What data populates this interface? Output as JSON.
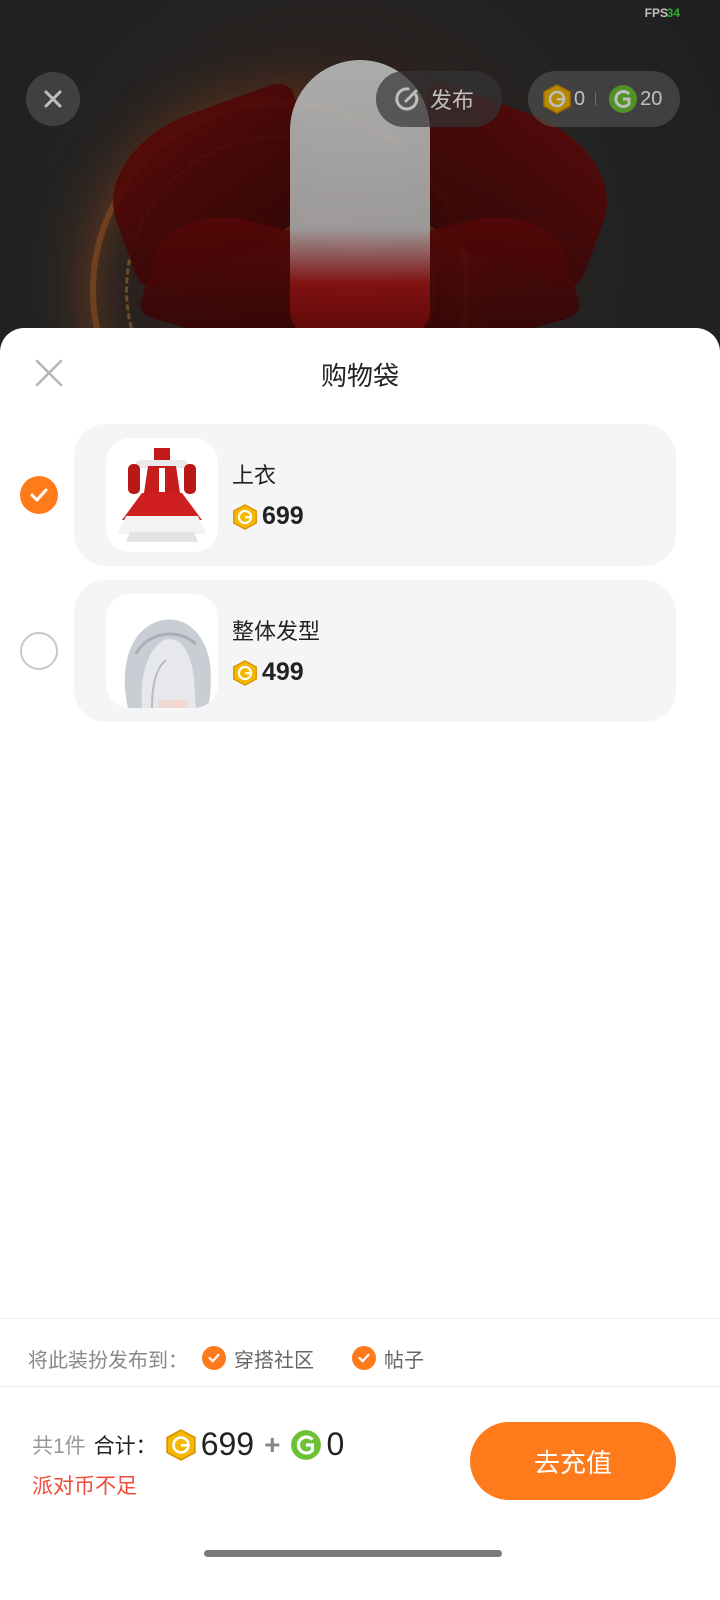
{
  "status": {
    "fps_label": "FPS",
    "fps_value": "34",
    "fps_color": "#39e639"
  },
  "topbar": {
    "publish_label": "发布",
    "gold_coins": "0",
    "green_coins": "20"
  },
  "sheet": {
    "title": "购物袋",
    "items": [
      {
        "name": "上衣",
        "price": "699",
        "selected": true,
        "thumb": "red-dress-thumbnail"
      },
      {
        "name": "整体发型",
        "price": "499",
        "selected": false,
        "thumb": "silver-hair-thumbnail"
      }
    ],
    "share": {
      "label": "将此装扮发布到：",
      "options": [
        {
          "label": "穿搭社区",
          "checked": true
        },
        {
          "label": "帖子",
          "checked": true
        }
      ]
    },
    "summary": {
      "count_text": "共1件",
      "total_label": "合计：",
      "gold_total": "699",
      "plus": "+",
      "green_total": "0",
      "warning": "派对币不足"
    },
    "recharge_label": "去充值"
  },
  "colors": {
    "accent": "#ff7a1a",
    "gold": "#f5b800",
    "green": "#6cc234",
    "warning": "#f04a3a"
  }
}
